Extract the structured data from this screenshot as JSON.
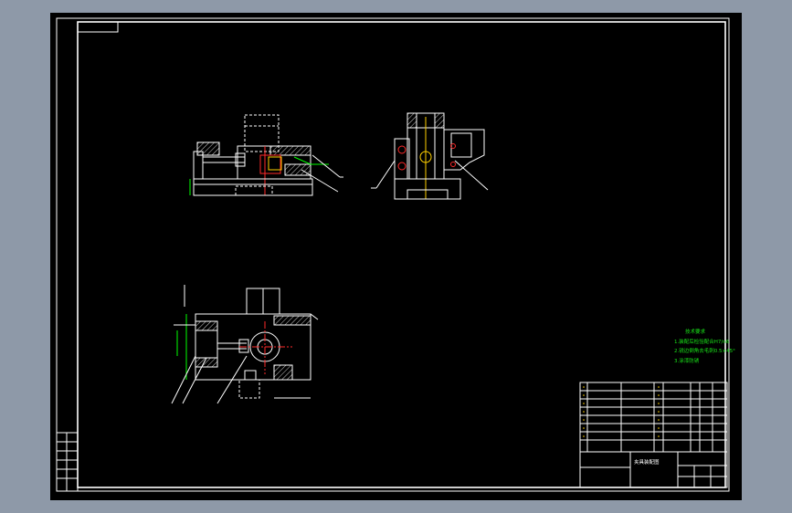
{
  "notes": {
    "title": "技术要求",
    "items": [
      "1.装配后检验配合H7/n6",
      "2.锐边倒角去毛刺0.5×45°",
      "3.涂漆防锈"
    ]
  },
  "title_block": {
    "drawing_title": "夹具装配图"
  }
}
